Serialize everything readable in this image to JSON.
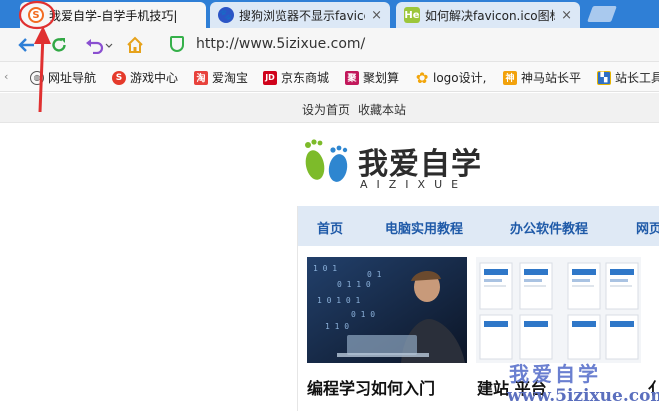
{
  "tabs": [
    {
      "title": "我爱自学-自学手机技巧|",
      "favicon": "sogou-favicon-icon",
      "active": true
    },
    {
      "title": "搜狗浏览器不显示favicon",
      "favicon": "baidu-paw-icon",
      "active": false
    },
    {
      "title": "如何解决favicon.ico图标",
      "favicon": "he-favicon-icon",
      "active": false
    }
  ],
  "tab_close_glyph": "×",
  "address": {
    "url": "http://www.5izixue.com/"
  },
  "bookmarks": [
    {
      "label": "网址导航",
      "icon": "globe-icon"
    },
    {
      "label": "游戏中心",
      "icon": "sogou-game-icon"
    },
    {
      "label": "爱淘宝",
      "icon": "taobao-icon"
    },
    {
      "label": "京东商城",
      "icon": "jd-icon"
    },
    {
      "label": "聚划算",
      "icon": "juhuasuan-icon"
    },
    {
      "label": "logo设计,",
      "icon": "gear-icon"
    },
    {
      "label": "神马站长平",
      "icon": "shenma-icon"
    },
    {
      "label": "站长工具",
      "icon": "tools-icon"
    }
  ],
  "bookmark_glyphs": {
    "taobao": "淘",
    "jd": "JD",
    "juhuasuan": "聚",
    "shenma": "神"
  },
  "site": {
    "top_links": [
      "设为首页",
      "收藏本站"
    ],
    "logo_cn": "我爱自学",
    "logo_en": "AIZIXUE",
    "nav": [
      "首页",
      "电脑实用教程",
      "办公软件教程",
      "网页"
    ],
    "cards": [
      {
        "caption": "编程学习如何入门"
      },
      {
        "caption": "建站 平台"
      }
    ],
    "watermark_cn": "我爱自学",
    "watermark_en": "www.5izixue.com"
  },
  "colors": {
    "tabstrip": "#2f7fd6",
    "annotation": "#e03030",
    "nav_text": "#1f5aa8",
    "logo_green": "#7dbb2a",
    "logo_blue": "#2e86d0"
  }
}
